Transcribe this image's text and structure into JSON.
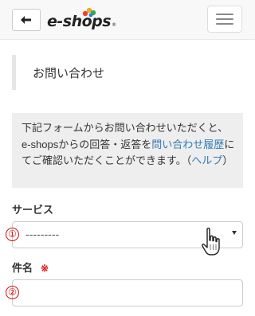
{
  "header": {
    "back_icon": "arrow-left-icon",
    "logo_text": "e-shops",
    "logo_reg": "®",
    "menu_icon": "hamburger-icon"
  },
  "page_title": "お問い合わせ",
  "info": {
    "text_1": "下記フォームからお問い合わせいただくと、e-shopsからの回答・返答を",
    "link_1": "問い合わせ履歴",
    "text_2": "にてご確認いただくことができます。（",
    "link_2": "ヘルプ",
    "text_3": "）"
  },
  "form": {
    "service": {
      "label": "サービス",
      "marker": "①",
      "selected_value": "---------"
    },
    "subject": {
      "label": "件名",
      "required_mark": "※",
      "marker": "②",
      "value": ""
    }
  },
  "colors": {
    "link": "#337ab7",
    "marker_red": "#d41010",
    "required_red": "#e01010"
  }
}
